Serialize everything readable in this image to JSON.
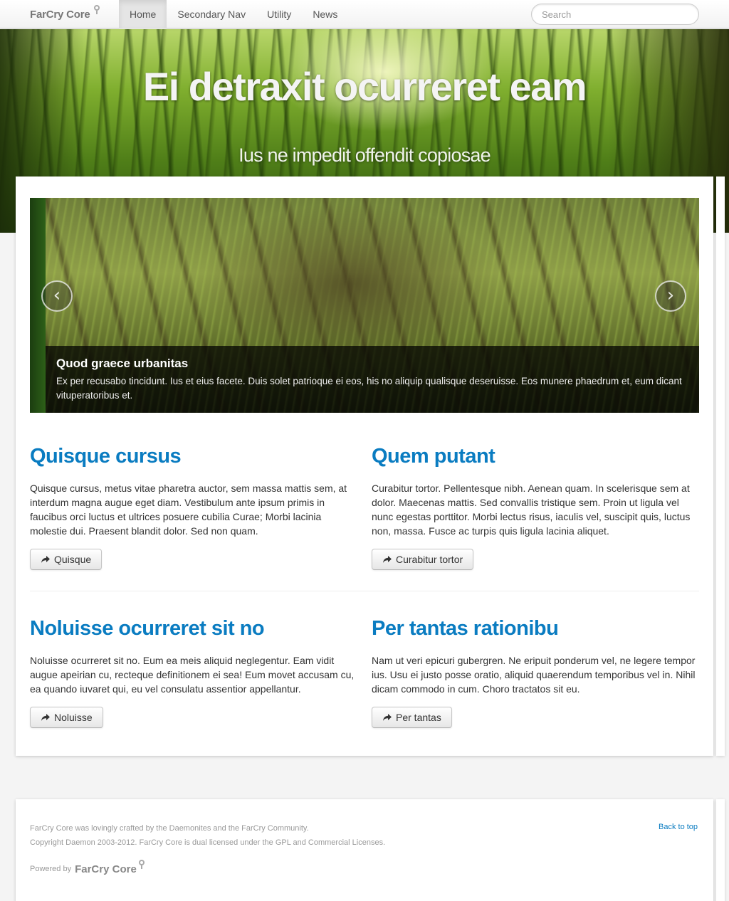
{
  "navbar": {
    "brand": "FarCry Core",
    "items": [
      {
        "label": "Home",
        "active": true
      },
      {
        "label": "Secondary Nav",
        "active": false
      },
      {
        "label": "Utility",
        "active": false
      },
      {
        "label": "News",
        "active": false
      }
    ],
    "search_placeholder": "Search"
  },
  "hero": {
    "title": "Ei detraxit ocurreret eam",
    "subtitle": "Ius ne impedit offendit copiosae"
  },
  "carousel": {
    "prev_icon": "chevron-left-icon",
    "next_icon": "chevron-right-icon",
    "prev_glyph": "‹",
    "next_glyph": "›",
    "caption_title": "Quod graece urbanitas",
    "caption_text": "Ex per recusabo tincidunt. Ius et eius facete. Duis solet patrioque ei eos, his no aliquip qualisque deseruisse. Eos munere phaedrum et, eum dicant vituperatoribus et."
  },
  "features": [
    {
      "title": "Quisque cursus",
      "text": "Quisque cursus, metus vitae pharetra auctor, sem massa mattis sem, at interdum magna augue eget diam. Vestibulum ante ipsum primis in faucibus orci luctus et ultrices posuere cubilia Curae; Morbi lacinia molestie dui. Praesent blandit dolor. Sed non quam.",
      "button": "Quisque"
    },
    {
      "title": "Quem putant",
      "text": "Curabitur tortor. Pellentesque nibh. Aenean quam. In scelerisque sem at dolor. Maecenas mattis. Sed convallis tristique sem. Proin ut ligula vel nunc egestas porttitor. Morbi lectus risus, iaculis vel, suscipit quis, luctus non, massa. Fusce ac turpis quis ligula lacinia aliquet.",
      "button": "Curabitur tortor"
    },
    {
      "title": "Noluisse ocurreret sit no",
      "text": "Noluisse ocurreret sit no. Eum ea meis aliquid neglegentur. Eam vidit augue apeirian cu, recteque definitionem ei sea! Eum movet accusam cu, ea quando iuvaret qui, eu vel consulatu assentior appellantur.",
      "button": "Noluisse"
    },
    {
      "title": "Per tantas rationibu",
      "text": "Nam ut veri epicuri gubergren. Ne eripuit ponderum vel, ne legere tempor ius. Usu ei justo posse oratio, aliquid quaerendum temporibus vel in. Nihil dicam commodo in cum. Choro tractatos sit eu.",
      "button": "Per tantas"
    }
  ],
  "footer": {
    "line1": "FarCry Core was lovingly crafted by the Daemonites and the FarCry Community.",
    "line2": "Copyright Daemon 2003-2012. FarCry Core is dual licensed under the GPL and Commercial Licenses.",
    "back_to_top": "Back to top",
    "powered_by": "Powered by",
    "powered_logo": "FarCry Core"
  },
  "colors": {
    "accent": "#0a7cc1",
    "footer_text": "#999999"
  }
}
